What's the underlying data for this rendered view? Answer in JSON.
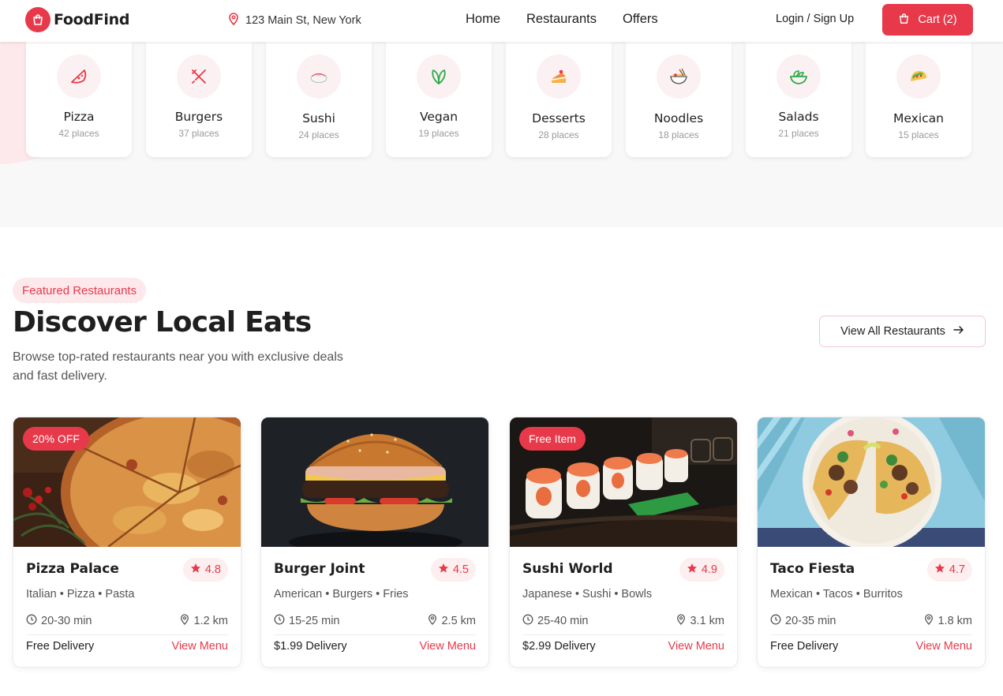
{
  "brand": {
    "name": "FoodFind",
    "accent": "#e8394a"
  },
  "header": {
    "location": "123 Main St, New York",
    "nav": [
      "Home",
      "Restaurants",
      "Offers"
    ],
    "login": "Login / Sign Up",
    "cart": "Cart (2)"
  },
  "categories": [
    {
      "name": "Pizza",
      "count": "42 places",
      "icon": "pizza-slice-icon"
    },
    {
      "name": "Burgers",
      "count": "37 places",
      "icon": "fork-knife-icon"
    },
    {
      "name": "Sushi",
      "count": "24 places",
      "icon": "sushi-icon"
    },
    {
      "name": "Vegan",
      "count": "19 places",
      "icon": "leaf-icon"
    },
    {
      "name": "Desserts",
      "count": "28 places",
      "icon": "cake-icon"
    },
    {
      "name": "Noodles",
      "count": "18 places",
      "icon": "noodle-bowl-icon"
    },
    {
      "name": "Salads",
      "count": "21 places",
      "icon": "salad-icon"
    },
    {
      "name": "Mexican",
      "count": "15 places",
      "icon": "taco-icon"
    }
  ],
  "featured": {
    "pill": "Featured Restaurants",
    "title": "Discover Local Eats",
    "subtitle": "Browse top-rated restaurants near you with exclusive deals and fast delivery.",
    "view_all": "View All Restaurants"
  },
  "restaurants": [
    {
      "name": "Pizza Palace",
      "rating": "4.8",
      "tags": "Italian • Pizza • Pasta",
      "time": "20-30 min",
      "distance": "1.2 km",
      "delivery": "Free Delivery",
      "cta": "View Menu",
      "badge": "20% OFF",
      "image": "pizza-photo"
    },
    {
      "name": "Burger Joint",
      "rating": "4.5",
      "tags": "American • Burgers • Fries",
      "time": "15-25 min",
      "distance": "2.5 km",
      "delivery": "$1.99 Delivery",
      "cta": "View Menu",
      "badge": "",
      "image": "burger-photo"
    },
    {
      "name": "Sushi World",
      "rating": "4.9",
      "tags": "Japanese • Sushi • Bowls",
      "time": "25-40 min",
      "distance": "3.1 km",
      "delivery": "$2.99 Delivery",
      "cta": "View Menu",
      "badge": "Free Item",
      "image": "sushi-photo"
    },
    {
      "name": "Taco Fiesta",
      "rating": "4.7",
      "tags": "Mexican • Tacos • Burritos",
      "time": "20-35 min",
      "distance": "1.8 km",
      "delivery": "Free Delivery",
      "cta": "View Menu",
      "badge": "",
      "image": "taco-photo"
    }
  ]
}
